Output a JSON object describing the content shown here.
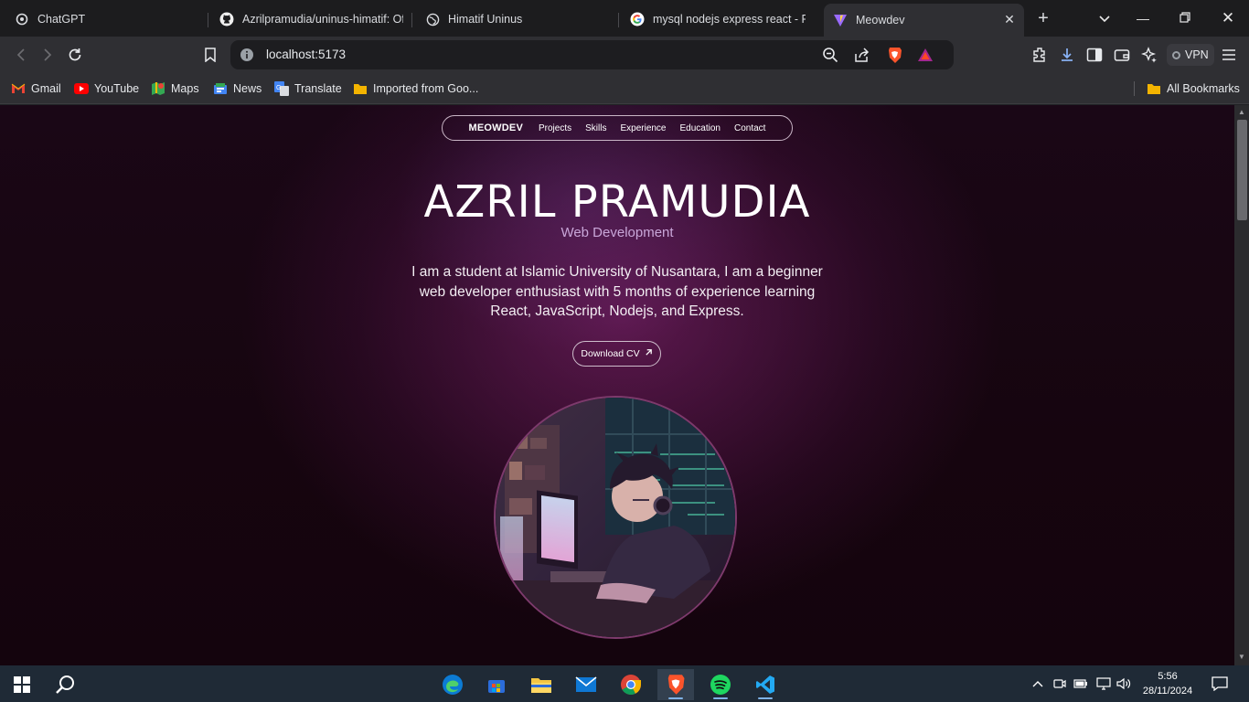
{
  "browser": {
    "tabs": [
      {
        "label": "ChatGPT",
        "icon": "chatgpt-icon"
      },
      {
        "label": "Azrilpramudia/uninus-himatif: Of",
        "icon": "github-icon"
      },
      {
        "label": "Himatif Uninus",
        "icon": "globe-icon"
      },
      {
        "label": "mysql nodejs express react - Penc",
        "icon": "google-icon"
      },
      {
        "label": "Meowdev",
        "icon": "vite-icon",
        "active": true
      }
    ],
    "address": "localhost:5173",
    "vpn_label": "VPN",
    "bookmarks": [
      {
        "label": "Gmail",
        "icon": "gmail-icon"
      },
      {
        "label": "YouTube",
        "icon": "youtube-icon"
      },
      {
        "label": "Maps",
        "icon": "maps-icon"
      },
      {
        "label": "News",
        "icon": "news-icon"
      },
      {
        "label": "Translate",
        "icon": "translate-icon"
      },
      {
        "label": "Imported from Goo...",
        "icon": "folder-icon"
      }
    ],
    "all_bookmarks": "All Bookmarks"
  },
  "site": {
    "nav": {
      "brand": "MEOWDEV",
      "links": [
        "Projects",
        "Skills",
        "Experience",
        "Education",
        "Contact"
      ]
    },
    "hero": {
      "name": "AZRIL PRAMUDIA",
      "role": "Web Development",
      "bio": "I am a student at Islamic University of Nusantara, I am a beginner web developer enthusiast with 5 months of experience learning React, JavaScript, Nodejs, and Express.",
      "cv_button": "Download CV",
      "cv_icon": "arrow-up-right-icon",
      "avatar": "anime-developer-portrait"
    },
    "colors": {
      "accent": "#c9a7d9",
      "background": "#1a0716"
    }
  },
  "taskbar": {
    "apps": [
      "edge-icon",
      "store-icon",
      "explorer-icon",
      "mail-icon",
      "chrome-icon",
      "brave-icon",
      "spotify-icon",
      "vscode-icon"
    ],
    "time": "5:56",
    "date": "28/11/2024"
  }
}
